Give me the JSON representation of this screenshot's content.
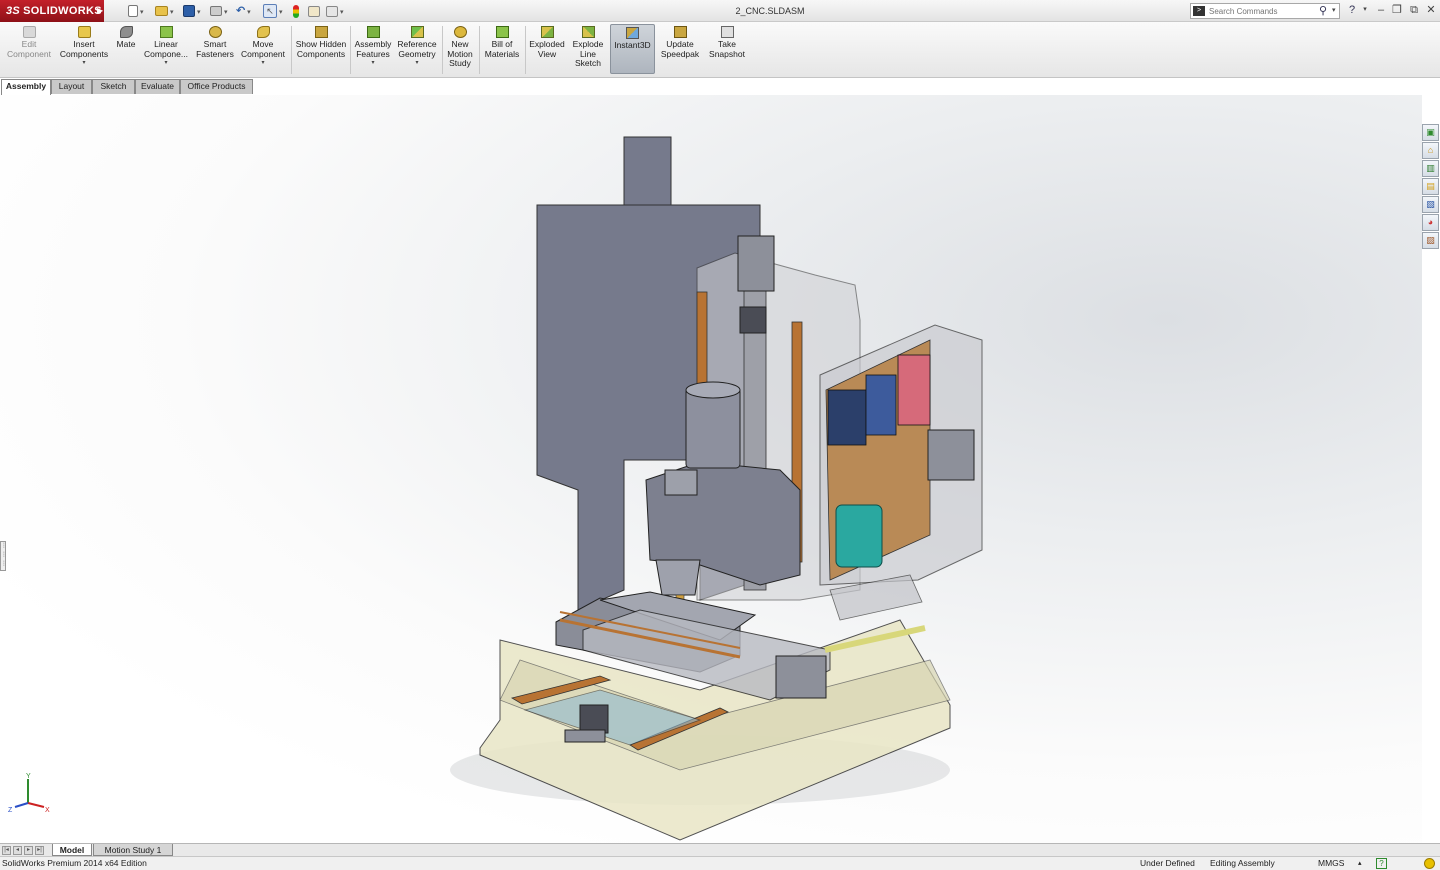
{
  "app": {
    "brand": "SOLIDWORKS",
    "brand_mark": "3S",
    "document_title": "2_CNC.SLDASM"
  },
  "search": {
    "placeholder": "Search Commands"
  },
  "command_manager": {
    "edit_component": "Edit Component",
    "insert_components": "Insert Components",
    "mate": "Mate",
    "linear_component_pattern": "Linear Compone...",
    "smart_fasteners": "Smart Fasteners",
    "move_component": "Move Component",
    "show_hidden_components": "Show Hidden Components",
    "assembly_features": "Assembly Features",
    "reference_geometry": "Reference Geometry",
    "new_motion_study": "New Motion Study",
    "bill_of_materials": "Bill of Materials",
    "exploded_view": "Exploded View",
    "explode_line_sketch": "Explode Line Sketch",
    "instant3d": "Instant3D",
    "update_speedpak": "Update Speedpak",
    "take_snapshot": "Take Snapshot"
  },
  "tabs": [
    "Assembly",
    "Layout",
    "Sketch",
    "Evaluate",
    "Office Products"
  ],
  "bottom_tabs": [
    "Model",
    "Motion Study 1"
  ],
  "triad": {
    "x": "X",
    "y": "Y",
    "z": "Z"
  },
  "status_bar": {
    "edition": "SolidWorks Premium 2014 x64 Edition",
    "definition": "Under Defined",
    "mode": "Editing Assembly",
    "units": "MMGS",
    "units_caret": "▴",
    "help": "?"
  },
  "colors": {
    "brand_red": "#b3141c",
    "viewport_gray": "#dcdfe3",
    "instant3d_active": "#aeb5be"
  }
}
